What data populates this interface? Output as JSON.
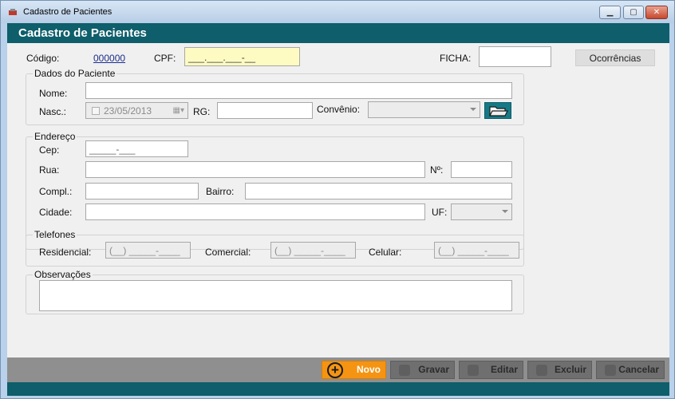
{
  "window": {
    "title": "Cadastro de Pacientes",
    "minimize_icon": "minimize-icon",
    "maximize_icon": "maximize-icon",
    "close_icon": "close-icon"
  },
  "header": {
    "title": "Cadastro de Pacientes"
  },
  "top": {
    "codigo_label": "Código:",
    "codigo_value": "000000",
    "cpf_label": "CPF:",
    "cpf_value": "___.___.___-__",
    "ficha_label": "FICHA:",
    "ficha_value": "",
    "ocorrencias_label": "Ocorrências"
  },
  "dados": {
    "legend": "Dados do Paciente",
    "nome_label": "Nome:",
    "nome_value": "",
    "nasc_label": "Nasc.:",
    "nasc_value": "23/05/2013",
    "rg_label": "RG:",
    "rg_value": "",
    "convenio_label": "Convênio:",
    "convenio_value": ""
  },
  "endereco": {
    "legend": "Endereço",
    "cep_label": "Cep:",
    "cep_value": "_____-___",
    "rua_label": "Rua:",
    "rua_value": "",
    "numero_label": "Nº:",
    "numero_value": "",
    "compl_label": "Compl.:",
    "compl_value": "",
    "bairro_label": "Bairro:",
    "bairro_value": "",
    "cidade_label": "Cidade:",
    "cidade_value": "",
    "uf_label": "UF:",
    "uf_value": ""
  },
  "telefones": {
    "legend": "Telefones",
    "residencial_label": "Residencial:",
    "residencial_value": "(__) _____-____",
    "comercial_label": "Comercial:",
    "comercial_value": "(__) _____-____",
    "celular_label": "Celular:",
    "celular_value": "(__) _____-____"
  },
  "observacoes": {
    "legend": "Observações",
    "value": ""
  },
  "actions": {
    "novo": "Novo",
    "gravar": "Gravar",
    "editar": "Editar",
    "excluir": "Excluir",
    "cancelar": "Cancelar"
  },
  "colors": {
    "header": "#0e5e6b",
    "accent_orange": "#f59412",
    "cpf_highlight": "#fdfbc2",
    "action_bar": "#8f8f8f"
  }
}
